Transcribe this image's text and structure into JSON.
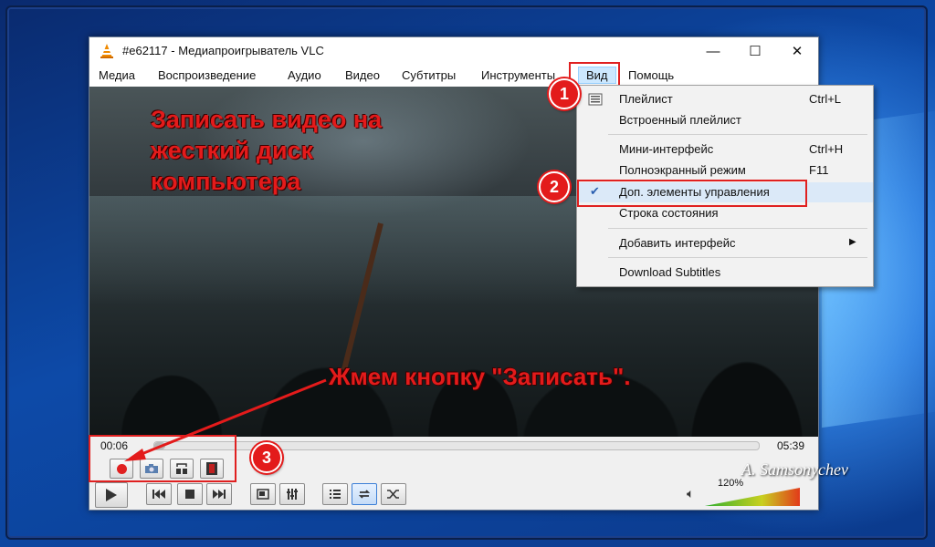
{
  "window": {
    "title": "#e62117 - Медиапроигрыватель VLC",
    "minimize_glyph": "—",
    "maximize_glyph": "☐",
    "close_glyph": "✕"
  },
  "menu": {
    "items": [
      "Медиа",
      "Воспроизведение",
      "Аудио",
      "Видео",
      "Субтитры",
      "Инструменты",
      "Вид",
      "Помощь"
    ],
    "active": "Вид"
  },
  "view_menu": {
    "items": [
      {
        "label": "Плейлист",
        "shortcut": "Ctrl+L",
        "icon": "playlist-icon"
      },
      {
        "label": "Встроенный плейлист",
        "shortcut": ""
      },
      {
        "label": "Мини-интерфейс",
        "shortcut": "Ctrl+H"
      },
      {
        "label": "Полноэкранный режим",
        "shortcut": "F11"
      },
      {
        "label": "Доп. элементы управления",
        "shortcut": "",
        "checked": true
      },
      {
        "label": "Строка состояния",
        "shortcut": ""
      },
      {
        "label": "Добавить интерфейс",
        "shortcut": "",
        "submenu": true
      },
      {
        "label": "Download Subtitles",
        "shortcut": ""
      }
    ]
  },
  "annotations": {
    "heading_line1": "Записать видео на",
    "heading_line2": "жесткий диск",
    "heading_line3": "компьютера",
    "press_record": "Жмем кнопку \"Записать\".",
    "badge1": "1",
    "badge2": "2",
    "badge3": "3",
    "accent_color": "#e31b1b"
  },
  "player": {
    "elapsed": "00:06",
    "duration": "05:39",
    "progress_fraction": 0.018,
    "volume": "120%",
    "volume_fraction": 1.0
  },
  "watermark": "A. Samsonychev"
}
